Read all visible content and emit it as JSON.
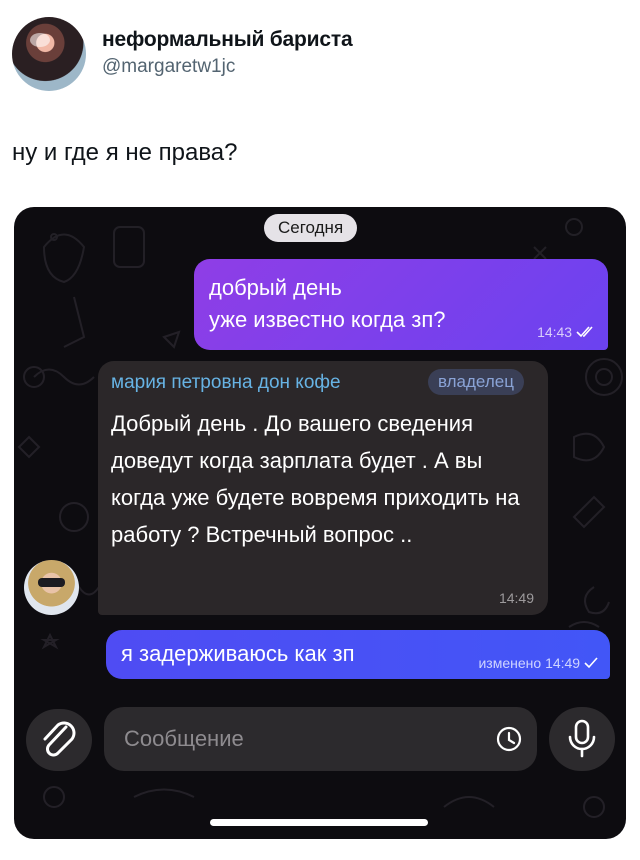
{
  "tweet": {
    "author_name": "неформальный бариста",
    "author_handle": "@margaretw1jc",
    "text": "ну и где я не права?"
  },
  "chat": {
    "date_label": "Сегодня",
    "messages": [
      {
        "direction": "outgoing",
        "lines": [
          "добрый день",
          "уже известно когда зп?"
        ],
        "time": "14:43",
        "status": "read-double-check"
      },
      {
        "direction": "incoming",
        "sender": "мария петровна дон кофе",
        "badge": "владелец",
        "text": "Добрый день . До вашего сведения доведут когда зарплата будет . А вы когда уже будете вовремя приходить на работу ? Встречный вопрос ..",
        "time": "14:49"
      },
      {
        "direction": "outgoing",
        "text": "я задерживаюсь как зп",
        "edited_label": "изменено",
        "time": "14:49",
        "status": "sent-check"
      }
    ],
    "composer": {
      "placeholder": "Сообщение",
      "attach_icon": "paperclip-icon",
      "sticker_icon": "sticker-clock-icon",
      "mic_icon": "microphone-icon"
    }
  },
  "colors": {
    "outgoing_bubble": "#7b42ee",
    "outgoing_bubble_2": "#4a52f5",
    "incoming_bubble": "#2b2729",
    "sender_name": "#67b3e4",
    "chat_background": "#0d0c10"
  }
}
